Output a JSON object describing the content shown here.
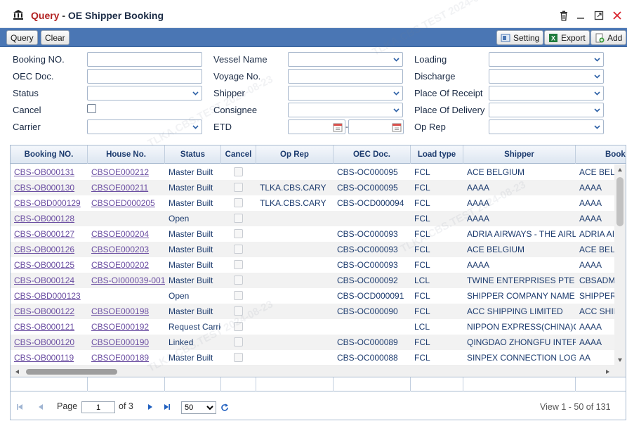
{
  "window": {
    "title_main": "Query",
    "title_sep": "-",
    "title_sub": "OE Shipper Booking"
  },
  "toolbar": {
    "query_label": "Query",
    "clear_label": "Clear",
    "setting_label": "Setting",
    "export_label": "Export",
    "add_label": "Add"
  },
  "form": {
    "booking_no": {
      "label": "Booking NO.",
      "value": ""
    },
    "oec_doc": {
      "label": "OEC Doc.",
      "value": ""
    },
    "status": {
      "label": "Status",
      "value": ""
    },
    "cancel": {
      "label": "Cancel",
      "checked": false
    },
    "carrier": {
      "label": "Carrier",
      "value": ""
    },
    "vessel_name": {
      "label": "Vessel Name",
      "value": ""
    },
    "voyage_no": {
      "label": "Voyage No.",
      "value": ""
    },
    "shipper": {
      "label": "Shipper",
      "value": ""
    },
    "consignee": {
      "label": "Consignee",
      "value": ""
    },
    "etd": {
      "label": "ETD",
      "from": "",
      "sep": "-",
      "to": ""
    },
    "loading": {
      "label": "Loading",
      "value": ""
    },
    "discharge": {
      "label": "Discharge",
      "value": ""
    },
    "place_of_receipt": {
      "label": "Place Of Receipt",
      "value": ""
    },
    "place_of_delivery": {
      "label": "Place Of Delivery",
      "value": ""
    },
    "op_rep": {
      "label": "Op Rep",
      "value": ""
    }
  },
  "grid": {
    "columns": [
      "Booking NO.",
      "House No.",
      "Status",
      "Cancel",
      "Op Rep",
      "OEC Doc.",
      "Load type",
      "Shipper",
      "Booking"
    ],
    "rows": [
      {
        "booking": "CBS-OB000131",
        "house": "CBSOE000212",
        "status": "Master Built",
        "op_rep": "",
        "oec": "CBS-OC000095",
        "load": "FCL",
        "shipper": "ACE BELGIUM",
        "booking_party": "ACE BELGIUM"
      },
      {
        "booking": "CBS-OB000130",
        "house": "CBSOE000211",
        "status": "Master Built",
        "op_rep": "TLKA.CBS.CARY",
        "oec": "CBS-OC000095",
        "load": "FCL",
        "shipper": "AAAA",
        "booking_party": "AAAA"
      },
      {
        "booking": "CBS-OBD000129",
        "house": "CBSOED000205",
        "status": "Master Built",
        "op_rep": "TLKA.CBS.CARY",
        "oec": "CBS-OCD000094",
        "load": "FCL",
        "shipper": "AAAA",
        "booking_party": "AAAA"
      },
      {
        "booking": "CBS-OB000128",
        "house": "",
        "status": "Open",
        "op_rep": "",
        "oec": "",
        "load": "FCL",
        "shipper": "AAAA",
        "booking_party": "AAAA"
      },
      {
        "booking": "CBS-OB000127",
        "house": "CBSOE000204",
        "status": "Master Built",
        "op_rep": "",
        "oec": "CBS-OC000093",
        "load": "FCL",
        "shipper": "ADRIA AIRWAYS - THE AIRLINE",
        "booking_party": "ADRIA AIRWAYS"
      },
      {
        "booking": "CBS-OB000126",
        "house": "CBSOE000203",
        "status": "Master Built",
        "op_rep": "",
        "oec": "CBS-OC000093",
        "load": "FCL",
        "shipper": "ACE BELGIUM",
        "booking_party": "ACE BELGIUM"
      },
      {
        "booking": "CBS-OB000125",
        "house": "CBSOE000202",
        "status": "Master Built",
        "op_rep": "",
        "oec": "CBS-OC000093",
        "load": "FCL",
        "shipper": "AAAA",
        "booking_party": "AAAA"
      },
      {
        "booking": "CBS-OB000124",
        "house": "CBS-OI000039-001",
        "status": "Master Built",
        "op_rep": "",
        "oec": "CBS-OC000092",
        "load": "LCL",
        "shipper": "TWINE ENTERPRISES PTE LTD",
        "booking_party": "CBSADMIN"
      },
      {
        "booking": "CBS-OBD000123",
        "house": "",
        "status": "Open",
        "op_rep": "",
        "oec": "CBS-OCD000091",
        "load": "FCL",
        "shipper": "SHIPPER COMPANY NAME",
        "booking_party": "SHIPPER"
      },
      {
        "booking": "CBS-OB000122",
        "house": "CBSOE000198",
        "status": "Master Built",
        "op_rep": "",
        "oec": "CBS-OC000090",
        "load": "FCL",
        "shipper": "ACC SHIPPING LIMITED",
        "booking_party": "ACC SHIPPING"
      },
      {
        "booking": "CBS-OB000121",
        "house": "CBSOE000192",
        "status": "Request Carrier",
        "op_rep": "",
        "oec": "",
        "load": "LCL",
        "shipper": "NIPPON EXPRESS(CHINA)CO.",
        "booking_party": "AAAA"
      },
      {
        "booking": "CBS-OB000120",
        "house": "CBSOE000190",
        "status": "Linked",
        "op_rep": "",
        "oec": "CBS-OC000089",
        "load": "FCL",
        "shipper": "QINGDAO ZHONGFU INTERNATIONAL",
        "booking_party": "AAAA"
      },
      {
        "booking": "CBS-OB000119",
        "house": "CBSOE000189",
        "status": "Master Built",
        "op_rep": "",
        "oec": "CBS-OC000088",
        "load": "FCL",
        "shipper": "SINPEX CONNECTION LOGISTICS",
        "booking_party": "AA"
      }
    ]
  },
  "pager": {
    "page_label": "Page",
    "page_value": "1",
    "of_label": "of 3",
    "page_size": "50",
    "view_text": "View 1 - 50 of 131"
  },
  "watermark": {
    "text": "TLKA.CBS.TEST 2024-08-23"
  }
}
